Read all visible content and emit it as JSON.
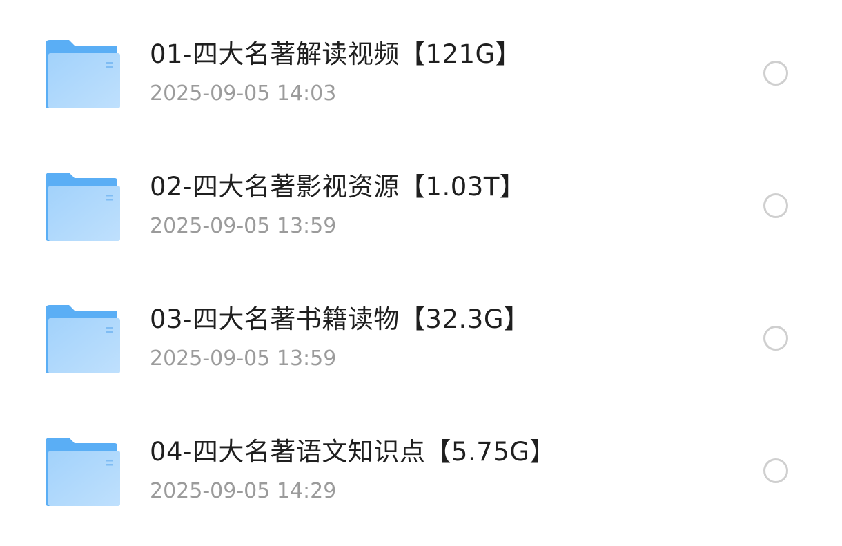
{
  "colors": {
    "folder_back": "#5aaef5",
    "folder_front_top": "#a2d2fb",
    "folder_front_bottom": "#bfe0fd",
    "name_text": "#1f1f1f",
    "date_text": "#9b9b9b",
    "radio_border": "#cfcfcf"
  },
  "files": [
    {
      "icon": "folder-icon",
      "name": "01-四大名著解读视频【121G】",
      "date": "2025-09-05 14:03",
      "selected": false
    },
    {
      "icon": "folder-icon",
      "name": "02-四大名著影视资源【1.03T】",
      "date": "2025-09-05 13:59",
      "selected": false
    },
    {
      "icon": "folder-icon",
      "name": "03-四大名著书籍读物【32.3G】",
      "date": "2025-09-05 13:59",
      "selected": false
    },
    {
      "icon": "folder-icon",
      "name": "04-四大名著语文知识点【5.75G】",
      "date": "2025-09-05 14:29",
      "selected": false
    }
  ]
}
